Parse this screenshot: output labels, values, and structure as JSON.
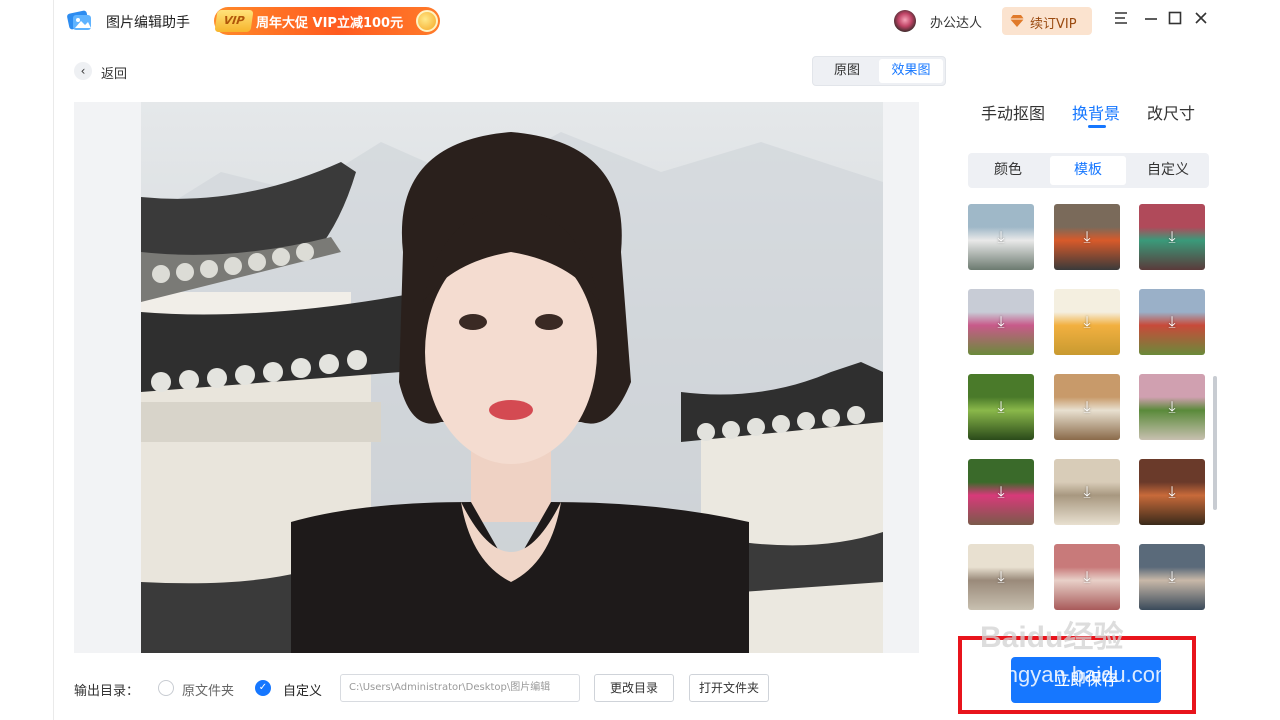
{
  "app": {
    "title": "图片编辑助手",
    "promo_vip": "VIP",
    "promo_text": "周年大促 VIP立减100元",
    "username": "办公达人",
    "renew_label": "续订VIP"
  },
  "nav": {
    "back_label": "返回",
    "view_original": "原图",
    "view_effect": "效果图"
  },
  "panel": {
    "tabs": [
      "手动抠图",
      "换背景",
      "改尺寸"
    ],
    "active_tab": "换背景",
    "segments": [
      "颜色",
      "模板",
      "自定义"
    ],
    "active_segment": "模板",
    "templates": [
      {
        "name": "car-white",
        "colors": [
          "#9fb8c8",
          "#e9e9e9",
          "#6c7a70"
        ]
      },
      {
        "name": "car-orange",
        "colors": [
          "#7a6a5a",
          "#d85a2a",
          "#3a3a3a"
        ]
      },
      {
        "name": "scooter-shop",
        "colors": [
          "#b04a5a",
          "#3a9a7a",
          "#5a3a3a"
        ]
      },
      {
        "name": "flower-mountain",
        "colors": [
          "#c8ccd6",
          "#c85a8a",
          "#6a8a3a"
        ]
      },
      {
        "name": "golden-field",
        "colors": [
          "#f4efe0",
          "#f2b040",
          "#c89a30"
        ]
      },
      {
        "name": "red-flower-field",
        "colors": [
          "#9ab0c8",
          "#c84a3a",
          "#6a8a3a"
        ]
      },
      {
        "name": "green-garden",
        "colors": [
          "#4a7a2a",
          "#8ab84a",
          "#2a4a1a"
        ]
      },
      {
        "name": "autumn-bridge",
        "colors": [
          "#c89a6a",
          "#e8e0d0",
          "#8a6a4a"
        ]
      },
      {
        "name": "stone-path",
        "colors": [
          "#d0a0b0",
          "#5a8a3a",
          "#c8c0b0"
        ]
      },
      {
        "name": "pink-flower-wall",
        "colors": [
          "#3a6a2a",
          "#d83a7a",
          "#7a5a4a"
        ]
      },
      {
        "name": "arched-corridor",
        "colors": [
          "#d8ccb8",
          "#a89880",
          "#e8e0d0"
        ]
      },
      {
        "name": "theater-hall",
        "colors": [
          "#6a3a2a",
          "#c86a3a",
          "#3a2a1a"
        ]
      },
      {
        "name": "grand-hallway",
        "colors": [
          "#e8e0d0",
          "#9a8a7a",
          "#c8c0b0"
        ]
      },
      {
        "name": "pink-room",
        "colors": [
          "#c87a7a",
          "#e8d0c8",
          "#a85a5a"
        ]
      },
      {
        "name": "palace-interior",
        "colors": [
          "#5a6a7a",
          "#c8b8a8",
          "#3a4a5a"
        ]
      }
    ]
  },
  "bottom": {
    "output_label": "输出目录：",
    "option_original": "原文件夹",
    "option_custom": "自定义",
    "path": "C:\\Users\\Administrator\\Desktop\\图片编辑",
    "change_dir": "更改目录",
    "open_folder": "打开文件夹",
    "save_label": "立即保存"
  },
  "watermark": {
    "brand": "Baidu经验",
    "url": "jingyan.baidu.com"
  },
  "colors": {
    "accent": "#1677ff",
    "highlight_box": "#e8141c",
    "promo": "#ff5a1f"
  }
}
